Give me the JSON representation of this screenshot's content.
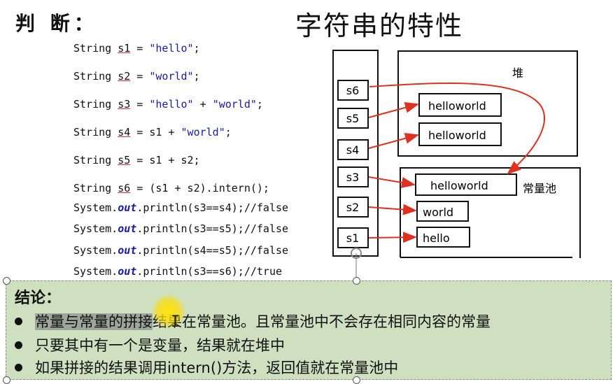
{
  "slide": {
    "judge_heading": "判 断：",
    "title": "字符串的特性"
  },
  "code_lines": [
    "String s1 = \"hello\";",
    "String s2 = \"world\";",
    "String s3 = \"hello\" + \"world\";",
    "String s4 = s1 + \"world\";",
    "String s5 = s1 + s2;",
    "String s6 = (s1 + s2).intern();",
    "System.out.println(s3==s4);//false",
    "System.out.println(s3==s5);//false",
    "System.out.println(s4==s5);//false",
    "System.out.println(s3==s6);//true"
  ],
  "diagram": {
    "stack_vars": [
      "s6",
      "s5",
      "s4",
      "s3",
      "s2",
      "s1"
    ],
    "heap_label": "堆",
    "heap_objects": [
      "helloworld",
      "helloworld"
    ],
    "pool_label": "常量池",
    "pool_objects": [
      "helloworld",
      "world",
      "hello"
    ],
    "arrow_color": "#e03020"
  },
  "conclusion": {
    "title": "结论：",
    "bullets": [
      "常量与常量的拼接结果在常量池。且常量池中不会存在相同内容的常量",
      "只要其中有一个是变量，结果就在堆中",
      "如果拼接的结果调用intern()方法，返回值就在常量池中"
    ]
  }
}
